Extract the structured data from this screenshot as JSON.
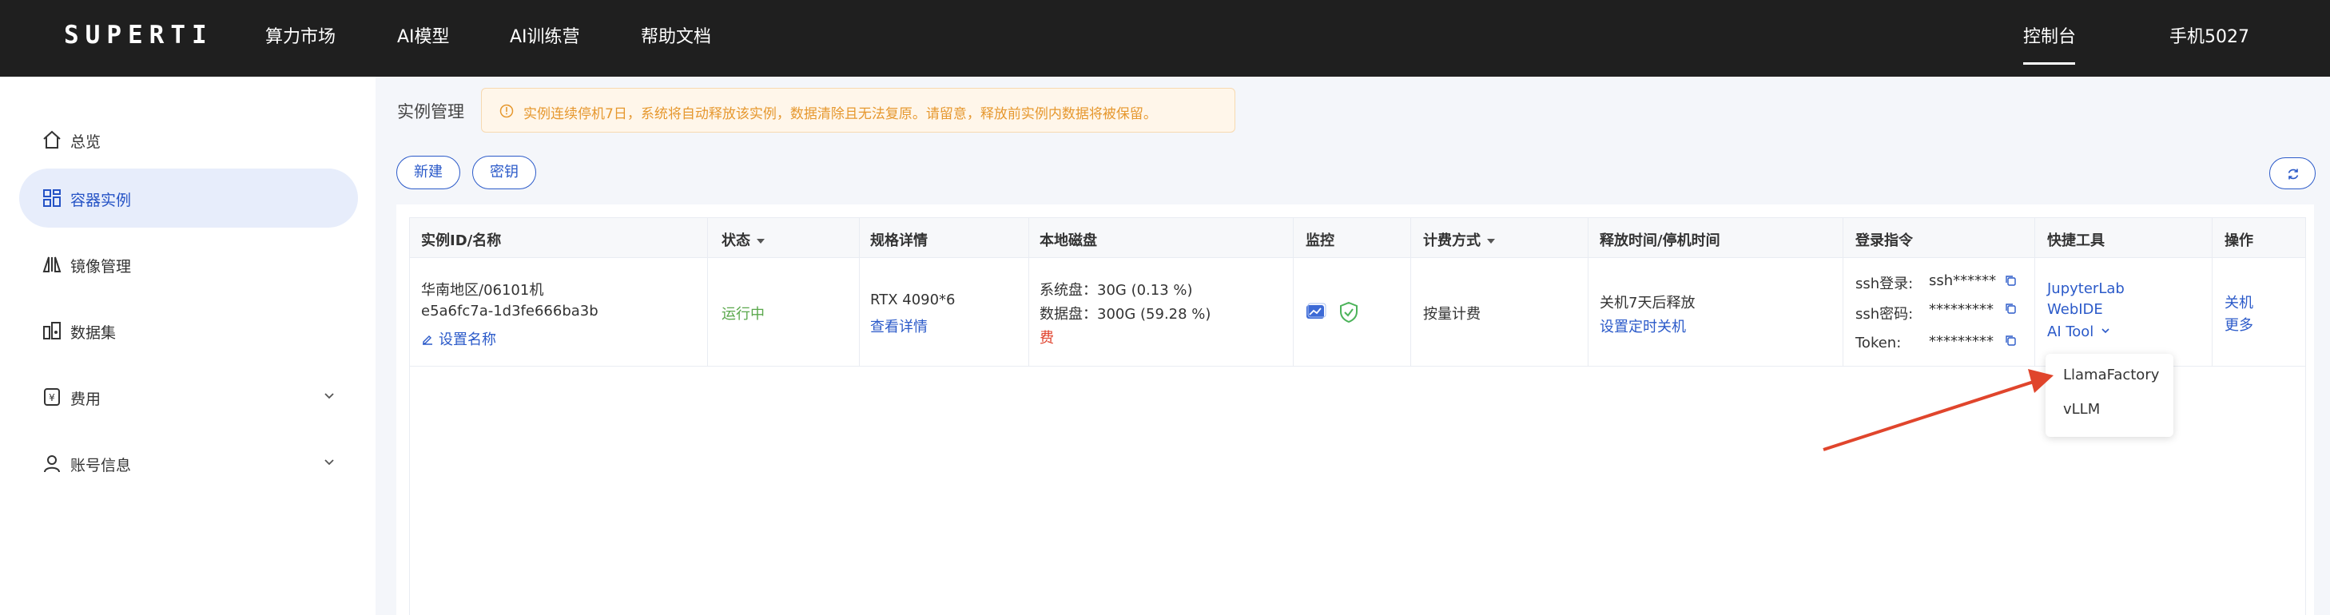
{
  "header": {
    "logo": "SUPERTI",
    "nav": [
      "算力市场",
      "AI模型",
      "AI训练营",
      "帮助文档"
    ],
    "console": "控制台",
    "user": "手机5027"
  },
  "sidebar": {
    "items": [
      {
        "label": "总览",
        "icon": "home-icon"
      },
      {
        "label": "容器实例",
        "icon": "grid-icon",
        "active": true
      },
      {
        "label": "镜像管理",
        "icon": "image-icon"
      },
      {
        "label": "数据集",
        "icon": "dataset-icon"
      },
      {
        "label": "费用",
        "icon": "yuan-icon"
      },
      {
        "label": "账号信息",
        "icon": "user-icon"
      }
    ]
  },
  "main": {
    "title": "实例管理",
    "warning": "实例连续停机7日，系统将自动释放该实例，数据清除且无法复原。请留意，释放前实例内数据将被保留。",
    "buttons": {
      "new": "新建",
      "key": "密钥"
    }
  },
  "table": {
    "headers": [
      "实例ID/名称",
      "状态",
      "规格详情",
      "本地磁盘",
      "监控",
      "计费方式",
      "释放时间/停机时间",
      "登录指令",
      "快捷工具",
      "操作"
    ],
    "row": {
      "region": "华南地区/06101机",
      "instance_id": "e5a6fc7a-1d3fe666ba3b",
      "set_name": "设置名称",
      "status": "运行中",
      "spec": "RTX 4090*6",
      "spec_link": "查看详情",
      "disk_system": "系统盘：30G (0.13 %)",
      "disk_data": "数据盘：300G (59.28 %)",
      "disk_fee": "费",
      "billing": "按量计费",
      "release": "关机7天后释放",
      "release_link": "设置定时关机",
      "login": {
        "ssh_login_label": "ssh登录:",
        "ssh_login_value": "ssh******",
        "ssh_pwd_label": "ssh密码:",
        "ssh_pwd_value": "*********",
        "token_label": "Token:",
        "token_value": "*********"
      },
      "tools": {
        "jupyter": "JupyterLab",
        "webide": "WebIDE",
        "aitool": "AI Tool"
      },
      "actions": {
        "shutdown": "关机",
        "more": "更多"
      }
    }
  },
  "dropdown": {
    "items": [
      "LlamaFactory",
      "vLLM"
    ]
  },
  "colors": {
    "accent": "#2b5ac9",
    "running": "#5aa84c",
    "annotation": "#e0452c"
  }
}
